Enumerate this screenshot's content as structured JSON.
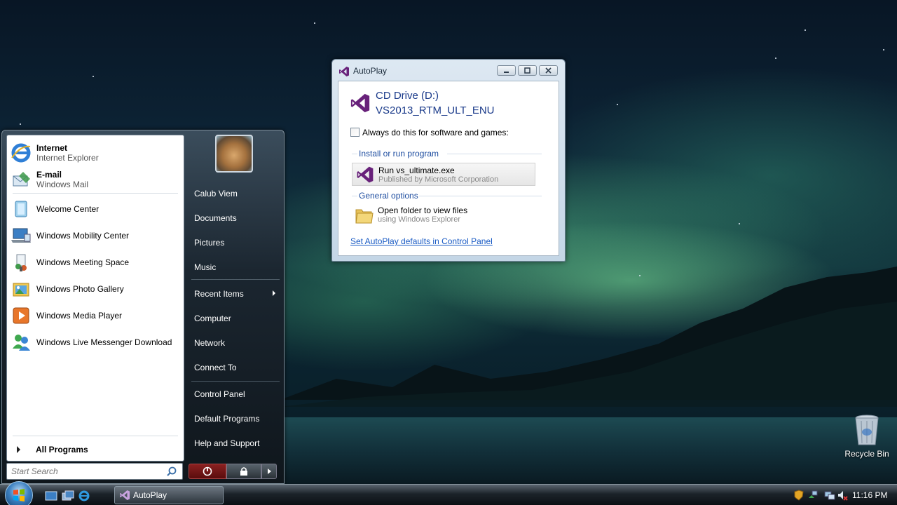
{
  "start_menu": {
    "pinned": [
      {
        "title": "Internet",
        "subtitle": "Internet Explorer"
      },
      {
        "title": "E-mail",
        "subtitle": "Windows Mail"
      }
    ],
    "recent": [
      {
        "label": "Welcome Center"
      },
      {
        "label": "Windows Mobility Center"
      },
      {
        "label": "Windows Meeting Space"
      },
      {
        "label": "Windows Photo Gallery"
      },
      {
        "label": "Windows Media Player"
      },
      {
        "label": "Windows Live Messenger Download"
      }
    ],
    "all_programs": "All Programs",
    "search_placeholder": "Start Search",
    "places": [
      "Calub Viem",
      "Documents",
      "Pictures",
      "Music",
      "Recent Items",
      "Computer",
      "Network",
      "Connect To",
      "Control Panel",
      "Default Programs",
      "Help and Support"
    ]
  },
  "autoplay": {
    "title": "AutoPlay",
    "drive_name": "CD Drive (D:)",
    "drive_label": "VS2013_RTM_ULT_ENU",
    "always_label": "Always do this for software and games:",
    "always_checked": false,
    "group_install": "Install or run program",
    "run_title": "Run vs_ultimate.exe",
    "run_sub": "Published by Microsoft Corporation",
    "group_general": "General options",
    "open_title": "Open folder to view files",
    "open_sub": "using Windows Explorer",
    "defaults_link": "Set AutoPlay defaults in Control Panel"
  },
  "desktop": {
    "recycle_bin": "Recycle Bin"
  },
  "taskbar": {
    "task_autoplay": "AutoPlay",
    "clock": "11:16 PM"
  },
  "colors": {
    "vs_purple": "#68217a",
    "link_blue": "#1a5bc4",
    "heading_blue": "#1a3a8a"
  }
}
